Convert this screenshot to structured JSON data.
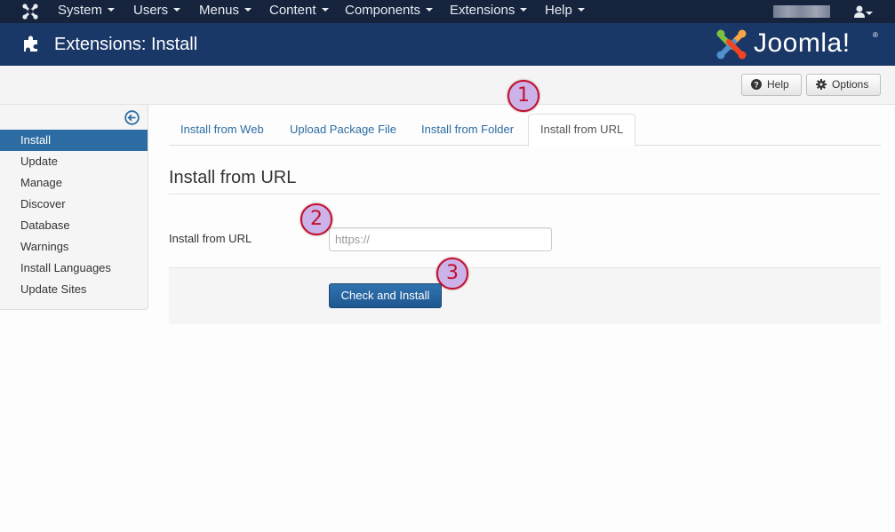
{
  "navbar": {
    "brand_icon": "joomla-x-icon",
    "menus": [
      {
        "label": "System"
      },
      {
        "label": "Users"
      },
      {
        "label": "Menus"
      },
      {
        "label": "Content"
      },
      {
        "label": "Components"
      },
      {
        "label": "Extensions"
      },
      {
        "label": "Help"
      }
    ],
    "user_icon": "user-icon"
  },
  "header": {
    "icon": "puzzle-piece-icon",
    "title": "Extensions: Install",
    "logo_text": "Joomla!",
    "logo_registered": "®"
  },
  "toolbar": {
    "help_label": "Help",
    "options_label": "Options"
  },
  "sidebar": {
    "collapse_icon": "arrow-left-circle-icon",
    "items": [
      {
        "label": "Install",
        "active": true
      },
      {
        "label": "Update"
      },
      {
        "label": "Manage"
      },
      {
        "label": "Discover"
      },
      {
        "label": "Database"
      },
      {
        "label": "Warnings"
      },
      {
        "label": "Install Languages"
      },
      {
        "label": "Update Sites"
      }
    ]
  },
  "tabs": [
    {
      "label": "Install from Web"
    },
    {
      "label": "Upload Package File"
    },
    {
      "label": "Install from Folder"
    },
    {
      "label": "Install from URL",
      "active": true
    }
  ],
  "main": {
    "section_title": "Install from URL",
    "field_label": "Install from URL",
    "url_value": "",
    "url_placeholder": "https://",
    "submit_label": "Check and Install"
  },
  "annotations": [
    "1",
    "2",
    "3"
  ],
  "colors": {
    "navbar_bg": "#15233d",
    "header_bg": "#1a3867",
    "accent": "#2d6ca2",
    "marker_border": "#c2102f",
    "marker_fill": "#cbb3ea"
  }
}
